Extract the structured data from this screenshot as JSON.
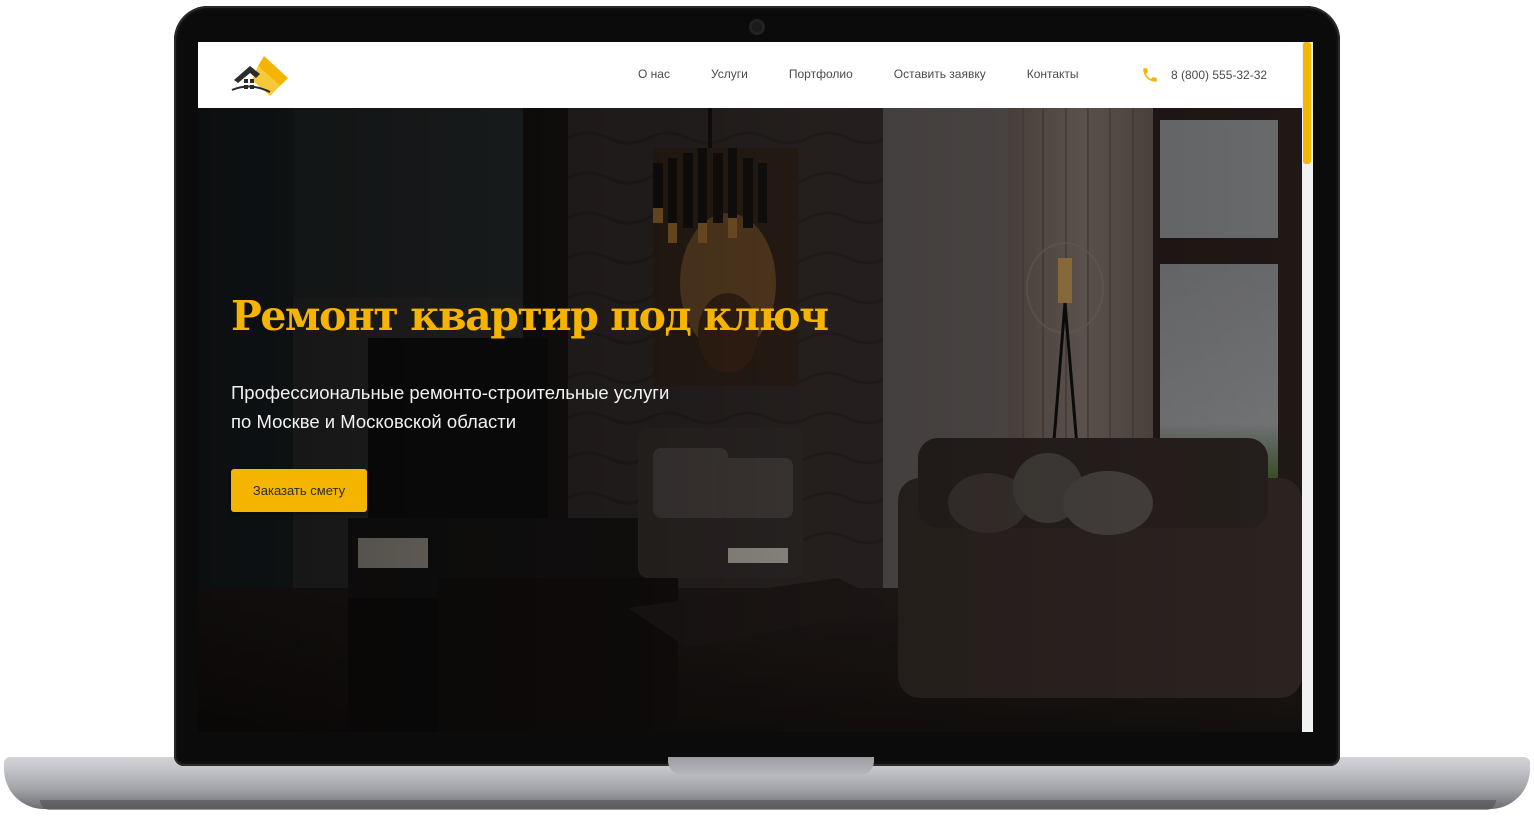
{
  "nav": {
    "items": [
      {
        "label": "О нас"
      },
      {
        "label": "Услуги"
      },
      {
        "label": "Портфолио"
      },
      {
        "label": "Оставить заявку"
      },
      {
        "label": "Контакты"
      }
    ],
    "phone": "8 (800) 555-32-32"
  },
  "hero": {
    "title": "Ремонт квартир под ключ",
    "subtitle_line1": "Профессиональные ремонто-строительные услуги",
    "subtitle_line2": "по Москве и Московской области",
    "cta_label": "Заказать смету"
  },
  "theme": {
    "accent": "#f5b400",
    "header_bg": "#ffffff",
    "nav_text": "#4a4a4a"
  },
  "icons": {
    "logo": "house-roof-logo",
    "phone": "phone-icon"
  }
}
